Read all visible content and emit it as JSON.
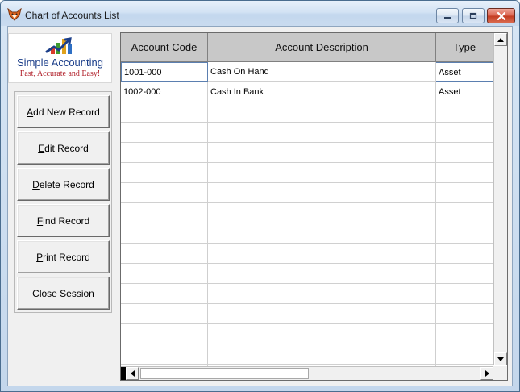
{
  "window": {
    "title": "Chart of Accounts List",
    "icon": "fox-app-icon"
  },
  "logo": {
    "name": "Simple Accounting",
    "tagline": "Fast, Accurate and Easy!"
  },
  "buttons": [
    {
      "key": "A",
      "label": "Add New Record",
      "rest": "dd New Record"
    },
    {
      "key": "E",
      "label": "Edit Record",
      "rest": "dit Record"
    },
    {
      "key": "D",
      "label": "Delete Record",
      "rest": "elete Record"
    },
    {
      "key": "F",
      "label": "Find Record",
      "rest": "ind Record"
    },
    {
      "key": "P",
      "label": "Print Record",
      "rest": "rint Record"
    },
    {
      "key": "C",
      "label": "Close Session",
      "rest": "lose Session"
    }
  ],
  "grid": {
    "columns": [
      "Account Code",
      "Account Description",
      "Type"
    ],
    "rows": [
      [
        "1001-000",
        "Cash On Hand",
        "Asset"
      ],
      [
        "1002-000",
        "Cash In Bank",
        "Asset"
      ]
    ]
  },
  "colors": {
    "titlebar": "#d3e3f4",
    "header": "#c8c8c8",
    "logo_blue": "#1c3f8a",
    "logo_red": "#b1202a",
    "close_button": "#c33b21"
  }
}
